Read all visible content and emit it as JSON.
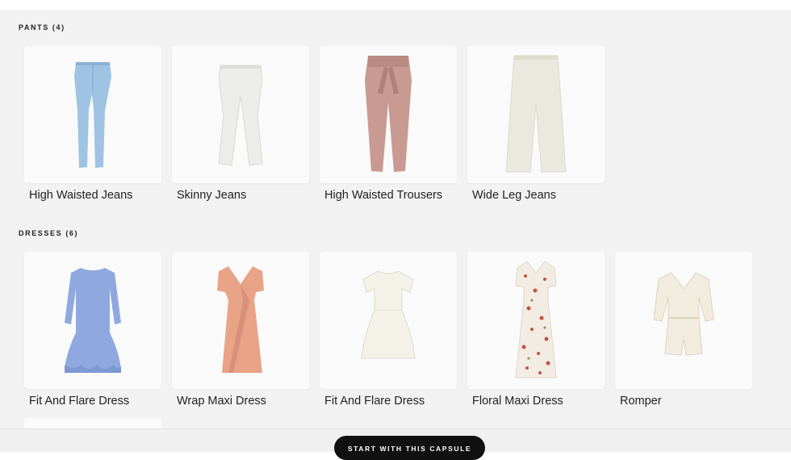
{
  "sections": {
    "pants": {
      "title": "PANTS (4)",
      "items": [
        {
          "name": "High Waisted Jeans",
          "icon": "light-blue-skinny-jeans"
        },
        {
          "name": "Skinny Jeans",
          "icon": "white-skinny-jeans"
        },
        {
          "name": "High Waisted Trousers",
          "icon": "dusty-pink-tie-waist-trousers"
        },
        {
          "name": "Wide Leg Jeans",
          "icon": "cream-wide-leg-jeans"
        }
      ]
    },
    "dresses": {
      "title": "DRESSES (6)",
      "items": [
        {
          "name": "Fit And Flare Dress",
          "icon": "periwinkle-fit-and-flare-dress"
        },
        {
          "name": "Wrap Maxi Dress",
          "icon": "peach-wrap-maxi-dress"
        },
        {
          "name": "Fit And Flare Dress",
          "icon": "ivory-fit-and-flare-dress"
        },
        {
          "name": "Floral Maxi Dress",
          "icon": "floral-print-maxi-dress"
        },
        {
          "name": "Romper",
          "icon": "cream-romper"
        }
      ]
    }
  },
  "cta": {
    "label": "START WITH THIS CAPSULE"
  },
  "colors": {
    "background": "#f2f2f2",
    "card": "#fafafa",
    "button": "#111111",
    "jeans_blue": "#9fc3e3",
    "pink": "#c89a92",
    "periwinkle": "#8fa9e0",
    "peach": "#e9a387"
  }
}
